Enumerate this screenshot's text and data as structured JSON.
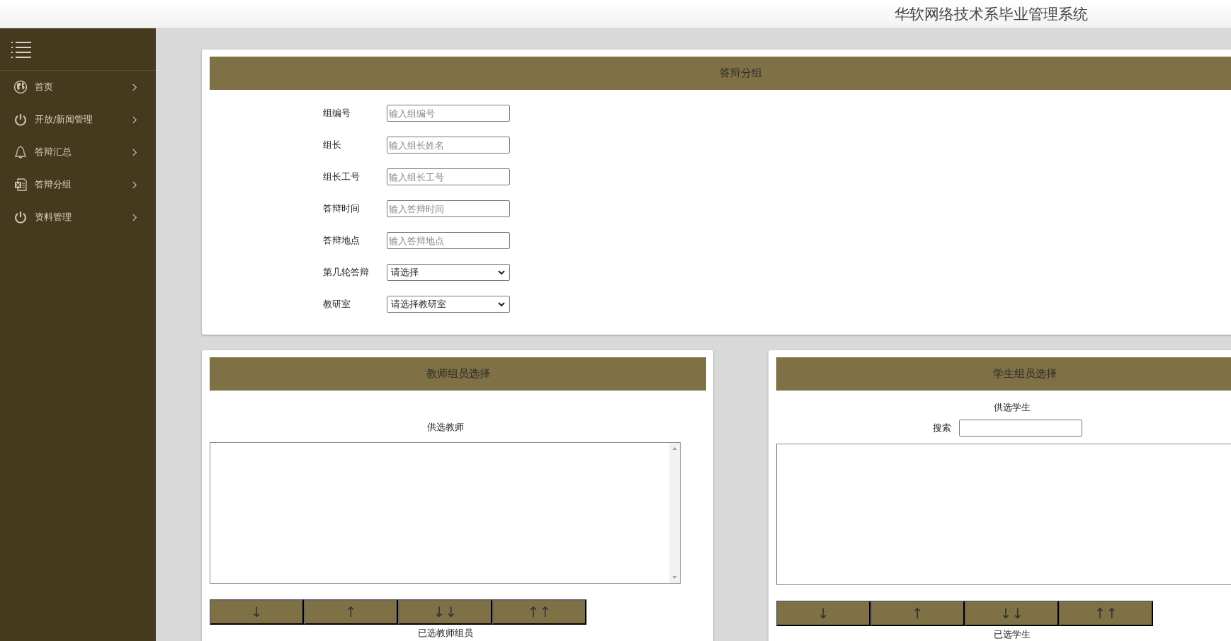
{
  "header": {
    "title": "华软网络技术系毕业管理系统"
  },
  "sidebar": {
    "items": [
      {
        "label": "首页",
        "kind": "globe"
      },
      {
        "label": "开放/新闻管理",
        "kind": "power"
      },
      {
        "label": "答辩汇总",
        "kind": "bell"
      },
      {
        "label": "答辩分组",
        "kind": "sheet"
      },
      {
        "label": "资料管理",
        "kind": "power"
      }
    ]
  },
  "group_form": {
    "title": "答辩分组",
    "fields": [
      {
        "label": "组编号",
        "kind": "input",
        "placeholder": "输入组编号"
      },
      {
        "label": "组长",
        "kind": "input",
        "placeholder": "输入组长姓名"
      },
      {
        "label": "组长工号",
        "kind": "input",
        "placeholder": "输入组长工号"
      },
      {
        "label": "答辩时间",
        "kind": "input",
        "placeholder": "输入答辩时间"
      },
      {
        "label": "答辩地点",
        "kind": "input",
        "placeholder": "输入答辩地点"
      },
      {
        "label": "第几轮答辩",
        "kind": "select",
        "value": "请选择"
      },
      {
        "label": "教研室",
        "kind": "select",
        "value": "请选择教研室"
      }
    ]
  },
  "panels": [
    {
      "title": "教师组员选择",
      "available_label": "供选教师",
      "list_scrollbar": true,
      "buttons": [
        "↓",
        "↑",
        "↓↓",
        "↑↑"
      ],
      "selected_label": "已选教师组员"
    },
    {
      "title": "学生组员选择",
      "available_label": "供选学生",
      "search": {
        "label": "搜索"
      },
      "buttons": [
        "↓",
        "↑",
        "↓↓",
        "↑↑"
      ],
      "selected_label": "已选学生"
    }
  ]
}
